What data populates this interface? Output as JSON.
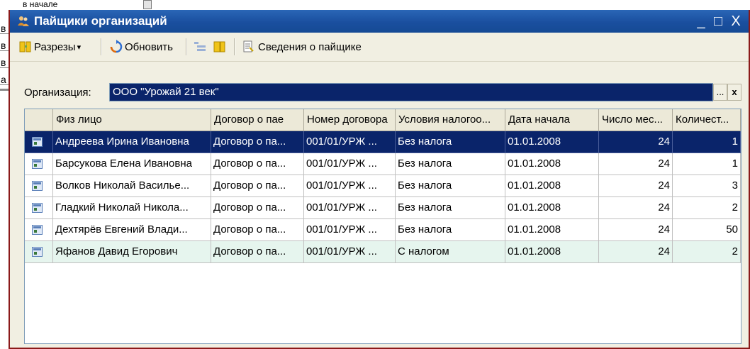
{
  "background_window": {
    "lines": [
      "в",
      "в",
      "в",
      "а"
    ],
    "top_fragment": "в начале"
  },
  "window": {
    "title": "Пайщики организаций",
    "minimize_glyph": "_",
    "maximize_glyph": "□",
    "close_glyph": "X"
  },
  "toolbar": {
    "sections_label": "Разрезы",
    "sections_arrow": "▾",
    "refresh_label": "Обновить",
    "info_label": "Сведения о пайщике"
  },
  "filter": {
    "org_label": "Организация:",
    "org_value": "ООО \"Урожай 21 век\"",
    "select_glyph": "...",
    "clear_glyph": "x"
  },
  "table": {
    "columns": [
      "Физ лицо",
      "Договор о пае",
      "Номер договора",
      "Условия налогоо...",
      "Дата начала",
      "Число мес...",
      "Количест..."
    ],
    "rows": [
      [
        "Андреева Ирина Ивановна",
        "Договор о па...",
        "001/01/УРЖ ...",
        "Без налога",
        "01.01.2008",
        "24",
        "1"
      ],
      [
        "Барсукова Елена Ивановна",
        "Договор о па...",
        "001/01/УРЖ ...",
        "Без налога",
        "01.01.2008",
        "24",
        "1"
      ],
      [
        "Волков Николай Василье...",
        "Договор о па...",
        "001/01/УРЖ ...",
        "Без налога",
        "01.01.2008",
        "24",
        "3"
      ],
      [
        "Гладкий Николай Никола...",
        "Договор о па...",
        "001/01/УРЖ ...",
        "Без налога",
        "01.01.2008",
        "24",
        "2"
      ],
      [
        "Дехтярёв Евгений Влади...",
        "Договор о па...",
        "001/01/УРЖ ...",
        "Без налога",
        "01.01.2008",
        "24",
        "50"
      ],
      [
        "Яфанов Давид Егорович",
        "Договор о па...",
        "001/01/УРЖ ...",
        "С налогом",
        "01.01.2008",
        "24",
        "2"
      ]
    ],
    "selected_row": 0,
    "highlighted_row": 5
  },
  "colors": {
    "title_bar": "#1a4f9f",
    "selection": "#0a246a",
    "window_border": "#8b1a1a",
    "highlight_row": "#e6f5ee"
  }
}
